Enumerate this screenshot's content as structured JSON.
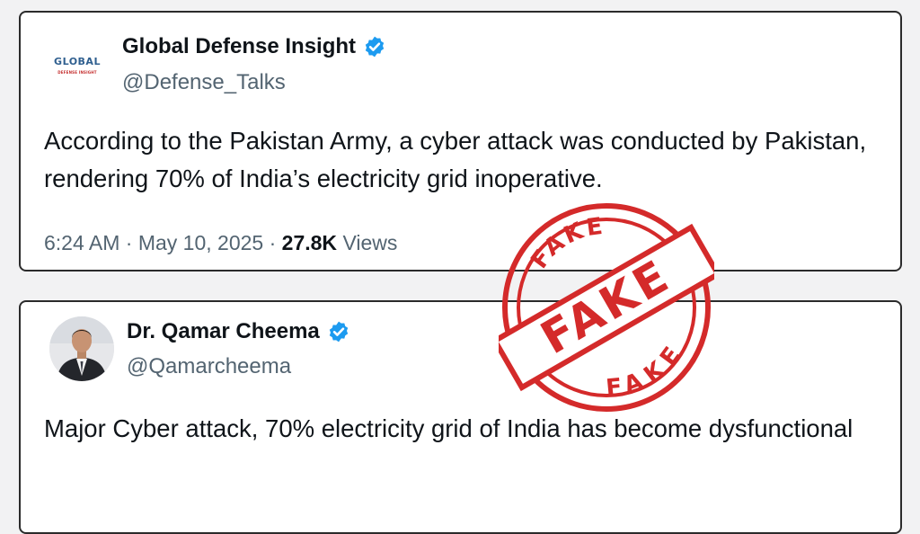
{
  "tweet1": {
    "logo_text": "GLOBAL",
    "logo_subtext": "DEFENSE INSIGHT",
    "name": "Global Defense Insight",
    "handle": "@Defense_Talks",
    "text": "According to the Pakistan Army, a cyber attack was conducted by Pakistan, rendering 70% of India’s electricity grid inoperative.",
    "time": "6:24 AM",
    "date": "May 10, 2025",
    "views_count": "27.8K",
    "views_label": "Views"
  },
  "tweet2": {
    "name": "Dr. Qamar Cheema",
    "handle": "@Qamarcheema",
    "text": "Major Cyber attack, 70% electricity grid of India has become dysfunctional"
  },
  "stamp": {
    "top_text": "FAKE",
    "main_text": "FAKE",
    "bottom_text": "FAKE",
    "color": "#d42a2a"
  },
  "colors": {
    "verified": "#1d9bf0",
    "secondary_text": "#536471",
    "primary_text": "#0f1419"
  }
}
